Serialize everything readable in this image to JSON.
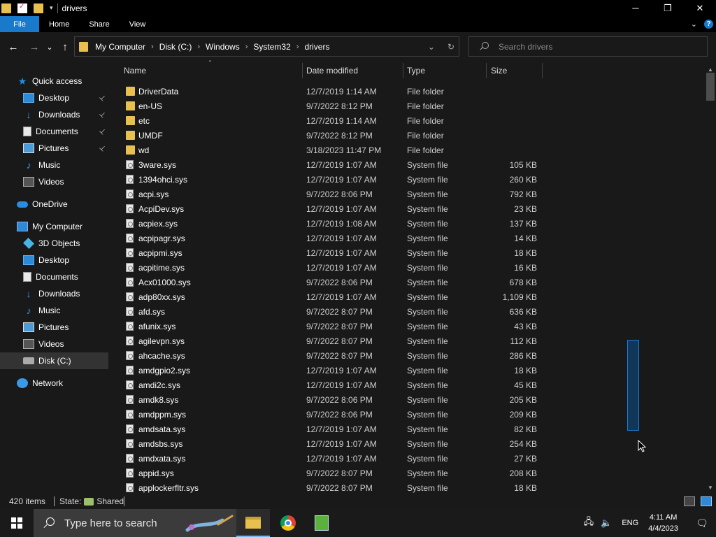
{
  "window": {
    "title": "drivers",
    "controls": {
      "minimize": "─",
      "maximize": "❐",
      "close": "✕"
    }
  },
  "ribbon": {
    "tabs": [
      "File",
      "Home",
      "Share",
      "View"
    ],
    "expand_icon": "⌄",
    "help_icon": "?"
  },
  "navigation": {
    "back": "←",
    "forward": "→",
    "recent": "⌄",
    "up": "↑",
    "breadcrumb": [
      "My Computer",
      "Disk (C:)",
      "Windows",
      "System32",
      "drivers"
    ],
    "crumb_separator": "›",
    "dropdown": "⌄",
    "refresh": "↻",
    "search_placeholder": "Search drivers"
  },
  "sidebar": {
    "items": [
      {
        "label": "Quick access",
        "icon": "star-icon",
        "indent": 0,
        "pinned": false
      },
      {
        "label": "Desktop",
        "icon": "desktop-icon",
        "indent": 1,
        "pinned": true
      },
      {
        "label": "Downloads",
        "icon": "download-icon",
        "indent": 1,
        "pinned": true
      },
      {
        "label": "Documents",
        "icon": "document-icon",
        "indent": 1,
        "pinned": true
      },
      {
        "label": "Pictures",
        "icon": "picture-icon",
        "indent": 1,
        "pinned": true
      },
      {
        "label": "Music",
        "icon": "music-icon",
        "indent": 1,
        "pinned": false
      },
      {
        "label": "Videos",
        "icon": "video-icon",
        "indent": 1,
        "pinned": false
      },
      {
        "label": "OneDrive",
        "icon": "cloud-icon",
        "indent": 0,
        "pinned": false
      },
      {
        "label": "My Computer",
        "icon": "computer-icon",
        "indent": 0,
        "pinned": false
      },
      {
        "label": "3D Objects",
        "icon": "cube-icon",
        "indent": 1,
        "pinned": false
      },
      {
        "label": "Desktop",
        "icon": "desktop-icon",
        "indent": 1,
        "pinned": false
      },
      {
        "label": "Documents",
        "icon": "document-icon",
        "indent": 1,
        "pinned": false
      },
      {
        "label": "Downloads",
        "icon": "download-icon",
        "indent": 1,
        "pinned": false
      },
      {
        "label": "Music",
        "icon": "music-icon",
        "indent": 1,
        "pinned": false
      },
      {
        "label": "Pictures",
        "icon": "picture-icon",
        "indent": 1,
        "pinned": false
      },
      {
        "label": "Videos",
        "icon": "video-icon",
        "indent": 1,
        "pinned": false
      },
      {
        "label": "Disk (C:)",
        "icon": "disk-icon",
        "indent": 1,
        "pinned": false,
        "selected": true
      },
      {
        "label": "Network",
        "icon": "network-icon",
        "indent": 0,
        "pinned": false
      }
    ],
    "pin_glyph": "📌"
  },
  "columns": {
    "name": "Name",
    "date": "Date modified",
    "type": "Type",
    "size": "Size",
    "sort_glyph": "⌃"
  },
  "files": [
    {
      "name": "DriverData",
      "date": "12/7/2019 1:14 AM",
      "type": "File folder",
      "size": "",
      "kind": "folder"
    },
    {
      "name": "en-US",
      "date": "9/7/2022 8:12 PM",
      "type": "File folder",
      "size": "",
      "kind": "folder"
    },
    {
      "name": "etc",
      "date": "12/7/2019 1:14 AM",
      "type": "File folder",
      "size": "",
      "kind": "folder"
    },
    {
      "name": "UMDF",
      "date": "9/7/2022 8:12 PM",
      "type": "File folder",
      "size": "",
      "kind": "folder"
    },
    {
      "name": "wd",
      "date": "3/18/2023 11:47 PM",
      "type": "File folder",
      "size": "",
      "kind": "folder"
    },
    {
      "name": "3ware.sys",
      "date": "12/7/2019 1:07 AM",
      "type": "System file",
      "size": "105 KB",
      "kind": "sys"
    },
    {
      "name": "1394ohci.sys",
      "date": "12/7/2019 1:07 AM",
      "type": "System file",
      "size": "260 KB",
      "kind": "sys"
    },
    {
      "name": "acpi.sys",
      "date": "9/7/2022 8:06 PM",
      "type": "System file",
      "size": "792 KB",
      "kind": "sys"
    },
    {
      "name": "AcpiDev.sys",
      "date": "12/7/2019 1:07 AM",
      "type": "System file",
      "size": "23 KB",
      "kind": "sys"
    },
    {
      "name": "acpiex.sys",
      "date": "12/7/2019 1:08 AM",
      "type": "System file",
      "size": "137 KB",
      "kind": "sys"
    },
    {
      "name": "acpipagr.sys",
      "date": "12/7/2019 1:07 AM",
      "type": "System file",
      "size": "14 KB",
      "kind": "sys"
    },
    {
      "name": "acpipmi.sys",
      "date": "12/7/2019 1:07 AM",
      "type": "System file",
      "size": "18 KB",
      "kind": "sys"
    },
    {
      "name": "acpitime.sys",
      "date": "12/7/2019 1:07 AM",
      "type": "System file",
      "size": "16 KB",
      "kind": "sys"
    },
    {
      "name": "Acx01000.sys",
      "date": "9/7/2022 8:06 PM",
      "type": "System file",
      "size": "678 KB",
      "kind": "sys"
    },
    {
      "name": "adp80xx.sys",
      "date": "12/7/2019 1:07 AM",
      "type": "System file",
      "size": "1,109 KB",
      "kind": "sys"
    },
    {
      "name": "afd.sys",
      "date": "9/7/2022 8:07 PM",
      "type": "System file",
      "size": "636 KB",
      "kind": "sys"
    },
    {
      "name": "afunix.sys",
      "date": "9/7/2022 8:07 PM",
      "type": "System file",
      "size": "43 KB",
      "kind": "sys"
    },
    {
      "name": "agilevpn.sys",
      "date": "9/7/2022 8:07 PM",
      "type": "System file",
      "size": "112 KB",
      "kind": "sys"
    },
    {
      "name": "ahcache.sys",
      "date": "9/7/2022 8:07 PM",
      "type": "System file",
      "size": "286 KB",
      "kind": "sys"
    },
    {
      "name": "amdgpio2.sys",
      "date": "12/7/2019 1:07 AM",
      "type": "System file",
      "size": "18 KB",
      "kind": "sys"
    },
    {
      "name": "amdi2c.sys",
      "date": "12/7/2019 1:07 AM",
      "type": "System file",
      "size": "45 KB",
      "kind": "sys"
    },
    {
      "name": "amdk8.sys",
      "date": "9/7/2022 8:06 PM",
      "type": "System file",
      "size": "205 KB",
      "kind": "sys"
    },
    {
      "name": "amdppm.sys",
      "date": "9/7/2022 8:06 PM",
      "type": "System file",
      "size": "209 KB",
      "kind": "sys"
    },
    {
      "name": "amdsata.sys",
      "date": "12/7/2019 1:07 AM",
      "type": "System file",
      "size": "82 KB",
      "kind": "sys"
    },
    {
      "name": "amdsbs.sys",
      "date": "12/7/2019 1:07 AM",
      "type": "System file",
      "size": "254 KB",
      "kind": "sys"
    },
    {
      "name": "amdxata.sys",
      "date": "12/7/2019 1:07 AM",
      "type": "System file",
      "size": "27 KB",
      "kind": "sys"
    },
    {
      "name": "appid.sys",
      "date": "9/7/2022 8:07 PM",
      "type": "System file",
      "size": "208 KB",
      "kind": "sys"
    },
    {
      "name": "applockerfltr.sys",
      "date": "9/7/2022 8:07 PM",
      "type": "System file",
      "size": "18 KB",
      "kind": "sys"
    }
  ],
  "status": {
    "item_count": "420 items",
    "state_label": "State:",
    "state_value": "Shared"
  },
  "taskbar": {
    "search_placeholder": "Type here to search",
    "language": "ENG",
    "time": "4:11 AM",
    "date": "4/4/2023",
    "apps": [
      "file-explorer-icon",
      "chrome-icon",
      "notepad-icon"
    ]
  },
  "colors": {
    "accent": "#1979ca",
    "background": "#191919",
    "folder": "#e8c04d",
    "selection": "#1a7ad0"
  }
}
